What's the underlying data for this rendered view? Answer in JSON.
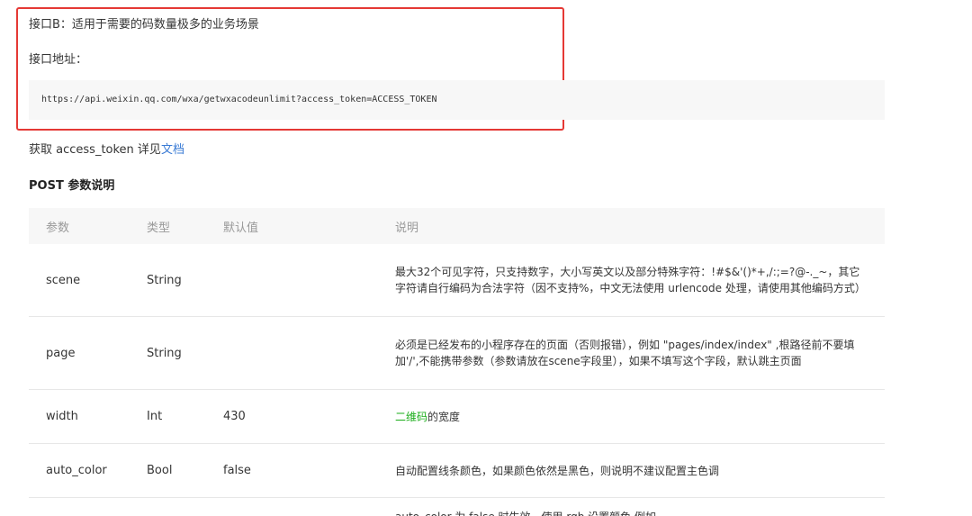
{
  "interface_b": {
    "title": "接口B：适用于需要的码数量极多的业务场景",
    "address_label": "接口地址：",
    "url": "https://api.weixin.qq.com/wxa/getwxacodeunlimit?access_token=ACCESS_TOKEN"
  },
  "token_note": {
    "prefix": "获取 access_token 详见",
    "link": "文档"
  },
  "post_title": "POST 参数说明",
  "table": {
    "headers": [
      "参数",
      "类型",
      "默认值",
      "说明"
    ],
    "rows": [
      {
        "param": "scene",
        "type": "String",
        "default": "",
        "desc": "最大32个可见字符，只支持数字，大小写英文以及部分特殊字符：!#$&'()*+,/:;=?@-._~，其它字符请自行编码为合法字符（因不支持%，中文无法使用 urlencode 处理，请使用其他编码方式）"
      },
      {
        "param": "page",
        "type": "String",
        "default": "",
        "desc": "必须是已经发布的小程序存在的页面（否则报错），例如 \"pages/index/index\" ,根路径前不要填加'/',不能携带参数（参数请放在scene字段里），如果不填写这个字段，默认跳主页面"
      },
      {
        "param": "width",
        "type": "Int",
        "default": "430",
        "desc_link": "二维码",
        "desc": "的宽度"
      },
      {
        "param": "auto_color",
        "type": "Bool",
        "default": "false",
        "desc": "自动配置线条颜色，如果颜色依然是黑色，则说明不建议配置主色调"
      },
      {
        "param": "",
        "type": "",
        "default": "",
        "desc": "auto_color 为 false 时生效，使用 rgb 设置颜色 例如"
      }
    ]
  },
  "colors": {
    "highlight_border": "#e53935",
    "link": "#3a7bd5",
    "green_link": "#1aad19",
    "header_bg": "#f7f7f7"
  }
}
